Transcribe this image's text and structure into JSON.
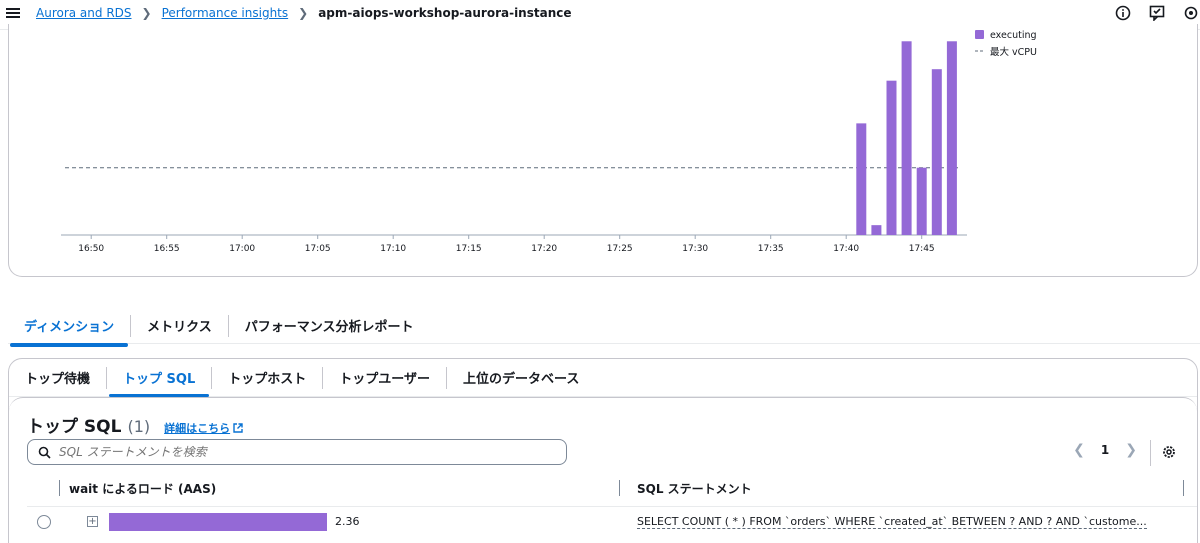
{
  "breadcrumb": {
    "items": [
      "Aurora and RDS",
      "Performance insights"
    ],
    "current": "apm-aiops-workshop-aurora-instance"
  },
  "top_icons": [
    "info-icon",
    "feedback-icon",
    "settings-gear-icon"
  ],
  "chart_data": {
    "type": "bar",
    "x_ticks": [
      "16:50",
      "16:55",
      "17:00",
      "17:05",
      "17:10",
      "17:15",
      "17:20",
      "17:25",
      "17:30",
      "17:35",
      "17:40",
      "17:45"
    ],
    "series": [
      {
        "name": "executing",
        "color": "#9469d6",
        "x": [
          "17:41",
          "17:42",
          "17:43",
          "17:44",
          "17:45",
          "17:46",
          "17:47"
        ],
        "values": [
          1.36,
          0.12,
          1.88,
          2.36,
          0.82,
          2.02,
          2.36
        ]
      }
    ],
    "reference_line": {
      "name": "最大 vCPU",
      "value": 0.82,
      "style": "dashed"
    },
    "ylim": [
      0,
      2.4
    ],
    "legend": "top-right"
  },
  "dimension_tabs": [
    {
      "label": "ディメンション",
      "active": true
    },
    {
      "label": "メトリクス",
      "active": false
    },
    {
      "label": "パフォーマンス分析レポート",
      "active": false
    }
  ],
  "sub_tabs": [
    {
      "label": "トップ待機",
      "active": false
    },
    {
      "label": "トップ SQL",
      "active": true
    },
    {
      "label": "トップホスト",
      "active": false
    },
    {
      "label": "トップユーザー",
      "active": false
    },
    {
      "label": "上位のデータベース",
      "active": false
    }
  ],
  "table": {
    "title": "トップ SQL",
    "count": "(1)",
    "info_link": "詳細はこちら",
    "search_placeholder": "SQL ステートメントを検索",
    "page": "1",
    "columns": [
      "wait によるロード (AAS)",
      "SQL ステートメント"
    ],
    "rows": [
      {
        "load": 2.36,
        "load_label": "2.36",
        "sql": "SELECT COUNT ( * ) FROM `orders` WHERE `created_at` BETWEEN ? AND ? AND `custome..."
      }
    ],
    "bar_color": "#9469d6"
  }
}
